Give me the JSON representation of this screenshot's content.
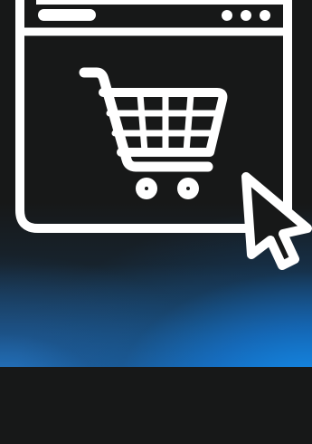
{
  "colors": {
    "background": "#171818",
    "icon_stroke": "#ffffff",
    "glow_blue": "#128ceb"
  },
  "icons": {
    "browser_window": "browser-window-icon",
    "shopping_cart": "shopping-cart-icon",
    "cursor": "mouse-cursor-icon"
  }
}
